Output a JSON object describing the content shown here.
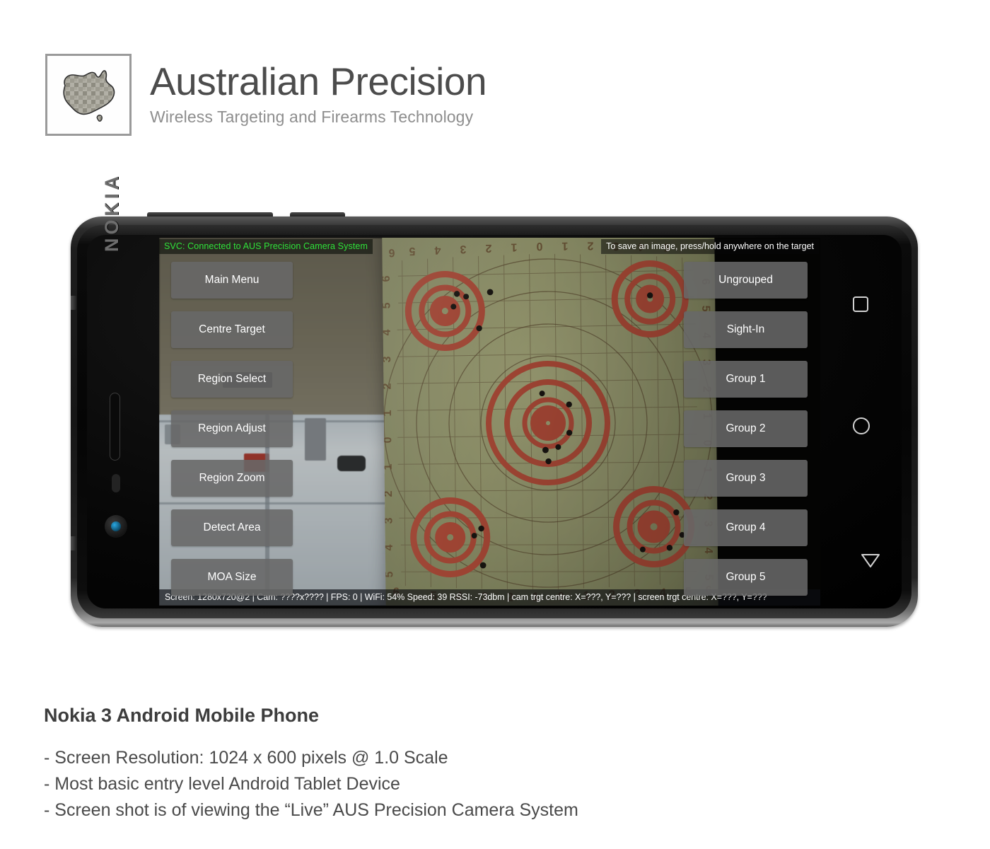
{
  "brand": {
    "logo_icon": "australia-map-icon",
    "title": "Australian Precision",
    "subtitle": "Wireless Targeting and Firearms Technology"
  },
  "phone": {
    "maker_mark": "NOKIA",
    "nav": {
      "recents_icon": "square-recents-icon",
      "home_icon": "circle-home-icon",
      "back_icon": "triangle-back-icon"
    },
    "hardware": {
      "earpiece": "earpiece-speaker",
      "proximity_sensor": "proximity-sensor",
      "front_camera": "front-camera-lens",
      "volume_button": "volume-rocker",
      "power_button": "power-button"
    }
  },
  "app": {
    "service_status": "SVC: Connected to AUS Precision Camera System",
    "save_hint": "To save an image, press/hold anywhere on the target",
    "status_bar": "Screen: 1280x720@2 | Cam: ????x???? | FPS: 0 | WiFi: 54% Speed: 39 RSSI: -73dbm | cam trgt centre: X=???, Y=??? | screen trgt centre: X=???, Y=???",
    "status_fields": {
      "screen": "1280x720@2",
      "cam": "????x????",
      "fps": "0",
      "wifi_percent": "54%",
      "speed": "39",
      "rssi": "-73dbm",
      "cam_target_centre": "X=???, Y=???",
      "screen_target_centre": "X=???, Y=???"
    },
    "left_buttons": [
      {
        "label": "Main Menu"
      },
      {
        "label": "Centre Target"
      },
      {
        "label": "Region Select"
      },
      {
        "label": "Region Adjust"
      },
      {
        "label": "Region Zoom"
      },
      {
        "label": "Detect Area"
      },
      {
        "label": "MOA Size"
      }
    ],
    "right_buttons": [
      {
        "label": "Ungrouped"
      },
      {
        "label": "Sight-In"
      },
      {
        "label": "Group 1"
      },
      {
        "label": "Group 2"
      },
      {
        "label": "Group 3"
      },
      {
        "label": "Group 4"
      },
      {
        "label": "Group 5"
      }
    ],
    "colors": {
      "status_green": "#2fe23a",
      "button_fill": "#686868",
      "button_text": "#ffffff",
      "target_ring_red": "#c0503c",
      "target_paper": "#a2a578"
    },
    "target_scale_labels": [
      "6",
      "5",
      "4",
      "3",
      "2",
      "1",
      "0",
      "1",
      "2",
      "3",
      "4",
      "5",
      "6"
    ]
  },
  "caption": {
    "title": "Nokia 3 Android Mobile Phone",
    "lines": [
      "- Screen Resolution: 1024 x 600 pixels @ 1.0 Scale",
      "- Most basic entry level Android Tablet Device",
      "- Screen shot is of viewing the “Live” AUS Precision Camera System"
    ]
  }
}
